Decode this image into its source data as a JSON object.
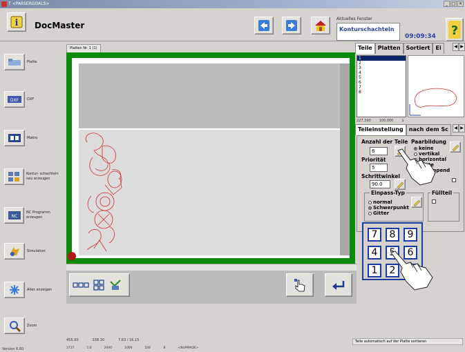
{
  "window": {
    "title": "T <PARSERGOALS>"
  },
  "header": {
    "app_title": "DocMaster",
    "aktuell_label": "Aktuelles Fenster",
    "aktuell_value": "Konturschachteln",
    "clock": "09:09:34",
    "help": "?"
  },
  "sidebar": {
    "items": [
      {
        "label": "Platte",
        "icon": "plate-icon"
      },
      {
        "label": "DXF",
        "icon": "dxf-icon"
      },
      {
        "label": "Makro",
        "icon": "macro-icon"
      },
      {
        "label": "Kontur- schachteln neu erzeugen",
        "icon": "nesting-icon"
      },
      {
        "label": "NC Programm erzeugen",
        "icon": "nc-program-icon"
      },
      {
        "label": "Simulation",
        "icon": "simulation-icon"
      },
      {
        "label": "Alles anzeigen",
        "icon": "zoom-all-icon"
      },
      {
        "label": "Zoom",
        "icon": "zoom-icon"
      }
    ]
  },
  "canvas": {
    "tab_label": "Platten Nr. 1 (1)"
  },
  "status": {
    "coords1": "455.00",
    "coords2": "338.30",
    "coords3": "7.63 / 16.15",
    "line2": [
      "3737",
      "1.0",
      "2000",
      "1000",
      "DXF",
      "8",
      "<NUMPADE>"
    ],
    "version": "Version 6.60",
    "hint": "Teile automatisch auf der Platte sortieren"
  },
  "right_panel": {
    "tabs_top": [
      "Teile",
      "Platten",
      "Sortiert",
      "Ei"
    ],
    "parts": [
      "1",
      "2",
      "3",
      "4",
      "5",
      "6",
      "7",
      "8"
    ],
    "selected_part": "1",
    "coord_a": "227.390",
    "coord_b": "100.000",
    "coord_c": "1",
    "tabs_mid": [
      "Teileinstellung",
      "nach dem Sc"
    ],
    "anzahl_label": "Anzahl der Teile",
    "anzahl_value": "6",
    "paarbildung_label": "Paarbildung",
    "paar_options": [
      "keine",
      "vertikal",
      "horizontal",
      "beste",
      "berlappend"
    ],
    "paar_selected": "keine",
    "prioritaet_label": "Priorität",
    "prioritaet_value": "5",
    "schrittwinkel_label": "Schrittwinkel",
    "schrittwinkel_value": "90.0",
    "check_label": "k",
    "einpass_label": "Einpass-Typ",
    "einpass_options": [
      "normal",
      "Schwerpunkt",
      "Gitter"
    ],
    "einpass_selected": "Schwerpunkt",
    "fuellteil_label": "Füllteil",
    "keypad": [
      "7",
      "8",
      "9",
      "4",
      "5",
      "6",
      "1",
      "2",
      "3"
    ]
  }
}
